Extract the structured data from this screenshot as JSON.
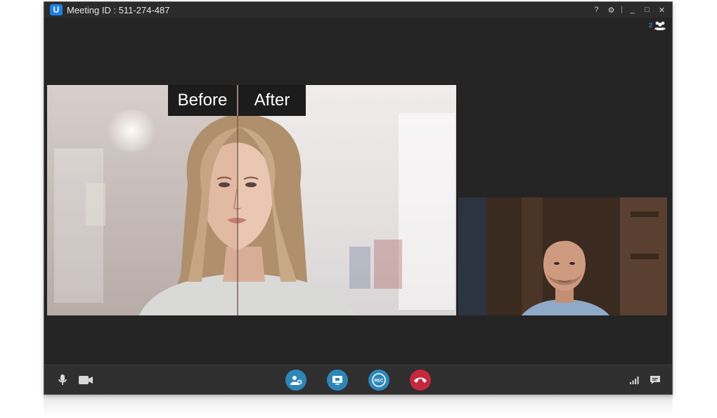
{
  "window": {
    "title": "Meeting ID : 511-274-487",
    "logo_letter": "U",
    "controls": [
      "help-icon",
      "settings-icon",
      "minimize-icon",
      "maximize-icon",
      "close-icon"
    ],
    "control_glyphs": {
      "help": "?",
      "settings": "⚙",
      "minimize": "_",
      "maximize": "□",
      "close": "✕"
    }
  },
  "participants": {
    "count": "2",
    "icon": "participants-icon"
  },
  "main_video": {
    "before_label": "Before",
    "after_label": "After"
  },
  "toolbar": {
    "left": [
      "microphone-icon",
      "camera-icon"
    ],
    "center": [
      "add-participant-icon",
      "screen-share-icon",
      "record-icon",
      "hang-up-icon"
    ],
    "record_label": "REC",
    "right": [
      "signal-icon",
      "chat-icon"
    ]
  },
  "colors": {
    "window_bg": "#242424",
    "titlebar": "#2b2b2b",
    "toolbar": "#2f2f2f",
    "accent_blue": "#1e7fe6",
    "action_teal": "#2d86b8",
    "hangup_red": "#c4283c"
  }
}
